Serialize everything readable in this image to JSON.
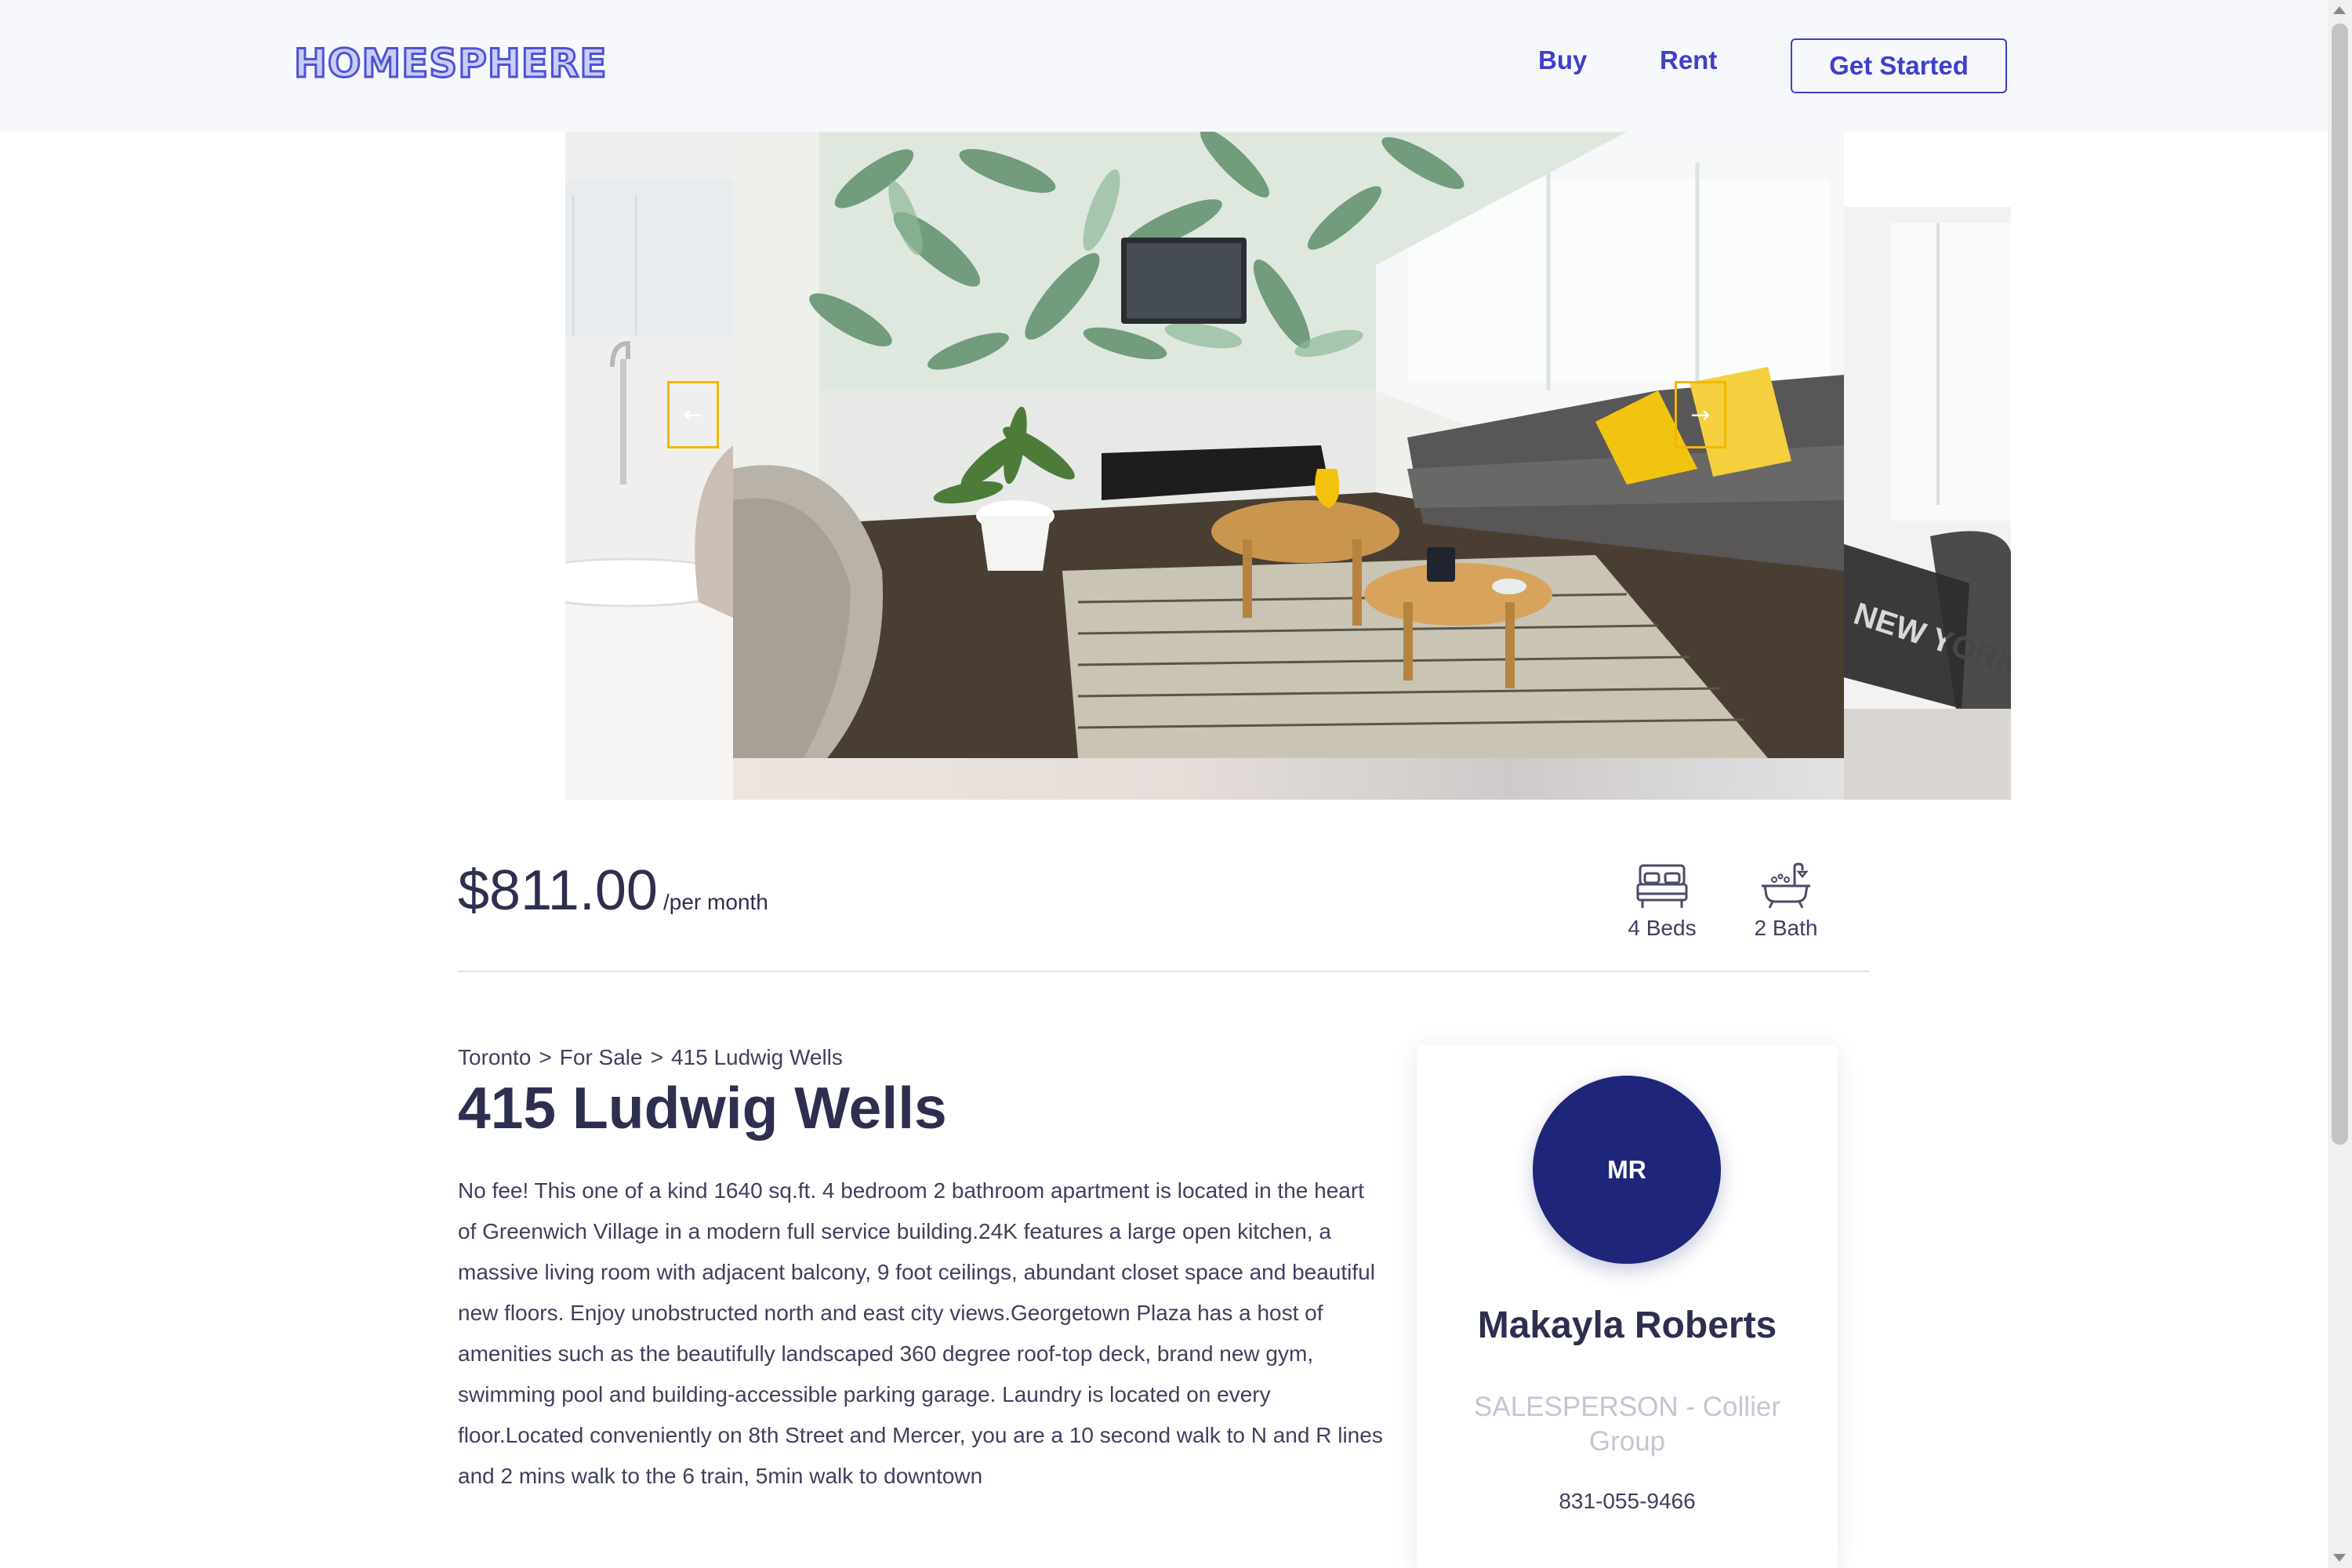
{
  "header": {
    "logo": "HOMESPHERE",
    "nav": {
      "buy": "Buy",
      "rent": "Rent"
    },
    "cta_label": "Get Started"
  },
  "gallery": {
    "prev_icon": "arrow-left-icon",
    "next_icon": "arrow-right-icon",
    "accent_color": "#f2b705"
  },
  "listing": {
    "price": "$811.00",
    "price_unit": "/per month",
    "beds": "4 Beds",
    "bath": "2 Bath",
    "breadcrumb": [
      "Toronto",
      "For Sale",
      "415 Ludwig Wells"
    ],
    "breadcrumb_separator": ">",
    "title": "415 Ludwig Wells",
    "description": "No fee! This one of a kind 1640 sq.ft. 4 bedroom 2 bathroom apartment is located in the heart of Greenwich Village in a modern full service building.24K features a large open kitchen, a massive living room with adjacent balcony, 9 foot ceilings, abundant closet space and beautiful new floors. Enjoy unobstructed north and east city views.Georgetown Plaza has a host of amenities such as the beautifully landscaped 360 degree roof-top deck, brand new gym, swimming pool and building-accessible parking garage. Laundry is located on every floor.Located conveniently on 8th Street and Mercer, you are a 10 second walk to N and R lines and 2 mins walk to the 6 train, 5min walk to downtown"
  },
  "agent": {
    "initials": "MR",
    "name": "Makayla Roberts",
    "role": "SALESPERSON - Collier Group",
    "phone": "831-055-9466",
    "avatar_color": "#1f2578"
  },
  "colors": {
    "brand": "#3d40c9",
    "text": "#2e2f4f",
    "muted": "#c3c5d3"
  }
}
